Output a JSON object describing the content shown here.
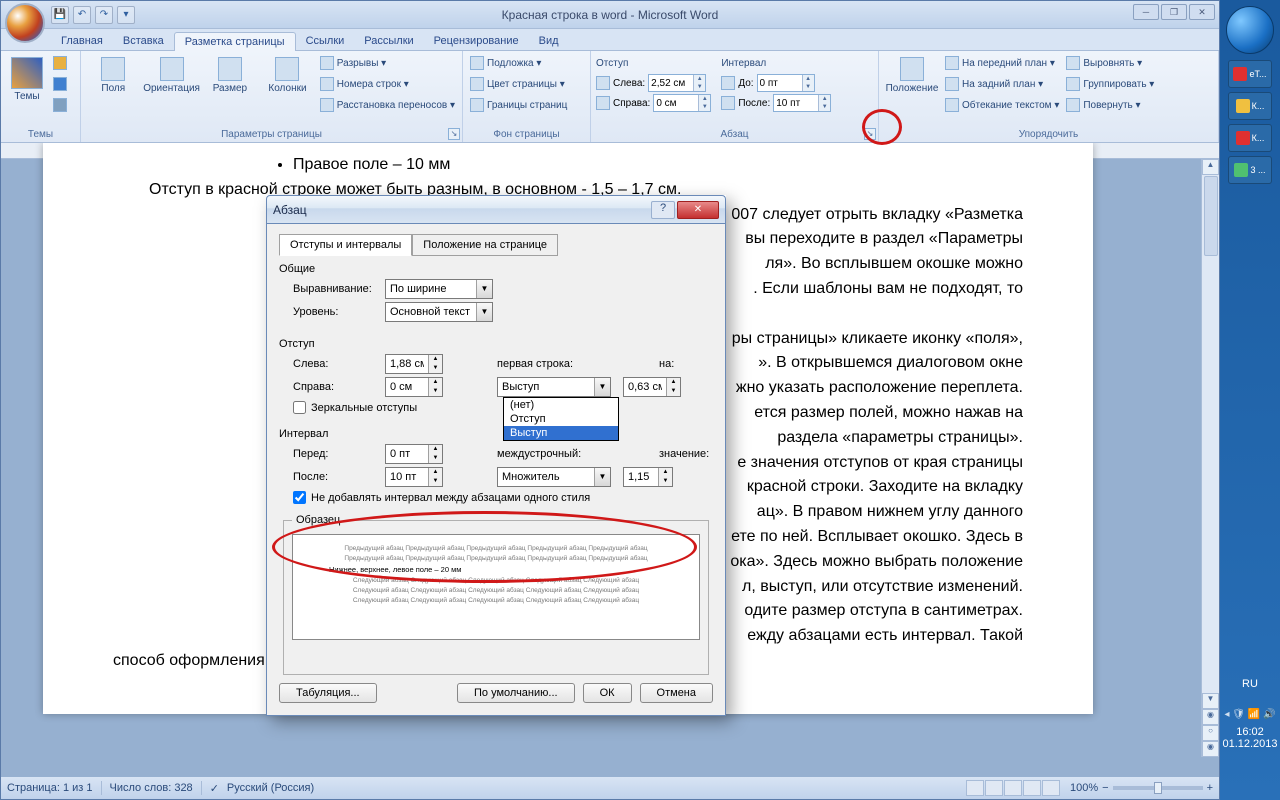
{
  "title": "Красная строка в word - Microsoft Word",
  "tabs": [
    "Главная",
    "Вставка",
    "Разметка страницы",
    "Ссылки",
    "Рассылки",
    "Рецензирование",
    "Вид"
  ],
  "active_tab": 2,
  "ribbon": {
    "themes": {
      "label": "Темы",
      "btn": "Темы"
    },
    "page_setup": {
      "label": "Параметры страницы",
      "margins": "Поля",
      "orientation": "Ориентация",
      "size": "Размер",
      "columns": "Колонки",
      "breaks": "Разрывы ▾",
      "line_numbers": "Номера строк ▾",
      "hyphenation": "Расстановка переносов ▾"
    },
    "page_bg": {
      "label": "Фон страницы",
      "watermark": "Подложка ▾",
      "page_color": "Цвет страницы ▾",
      "borders": "Границы страниц"
    },
    "paragraph": {
      "label": "Абзац",
      "indent_title": "Отступ",
      "left_lbl": "Слева:",
      "left_val": "2,52 см",
      "right_lbl": "Справа:",
      "right_val": "0 см",
      "spacing_title": "Интервал",
      "before_lbl": "До:",
      "before_val": "0 пт",
      "after_lbl": "После:",
      "after_val": "10 пт"
    },
    "arrange": {
      "label": "Упорядочить",
      "position": "Положение",
      "front": "На передний план ▾",
      "back": "На задний план ▾",
      "wrap": "Обтекание текстом ▾",
      "align": "Выровнять ▾",
      "group": "Группировать ▾",
      "rotate": "Повернуть ▾"
    }
  },
  "doc": {
    "bullet": "Правое поле – 10 мм",
    "p1": "Отступ в красной строке может быть разным, в основном  - 1,5 – 1,7 см.",
    "p2a": "007 следует отрыть вкладку «Разметка",
    "p2b": "вы переходите в раздел «Параметры",
    "p2c": "ля».  Во  всплывшем  окошке  можно",
    "p2d": ".  Если  шаблоны  вам  не  подходят,  то",
    "p3a": "ры  страницы»  кликаете  иконку  «поля»,",
    "p3b": "».  В  открывшемся  диалоговом  окне",
    "p3c": "жно указать расположение переплета.",
    "p3d": "ется  размер  полей,  можно  нажав  на",
    "p3e": "раздела «параметры страницы».",
    "p4a": "е  значения  отступов  от  края  страницы",
    "p4b": "красной строки. Заходите на вкладку",
    "p4c": "ац».  В правом нижнем углу данного",
    "p4d": "ете по ней. Всплывает окошко. Здесь в",
    "p4e": "ока». Здесь можно выбрать положение",
    "p4f": "л,  выступ,  или  отсутствие  изменений.",
    "p4g": "одите размер отступа в сантиметрах.",
    "p5a": "ежду абзацами есть интервал.  Такой",
    "p5b": "способ  оформления  более  удобен  для  небольших  документов.  Для  книг  или"
  },
  "dialog": {
    "title": "Абзац",
    "tab1": "Отступы и интервалы",
    "tab2": "Положение на странице",
    "general": "Общие",
    "align_lbl": "Выравнивание:",
    "align_val": "По ширине",
    "outline_lbl": "Уровень:",
    "outline_val": "Основной текст",
    "indent_title": "Отступ",
    "left_lbl": "Слева:",
    "left_val": "1,88 см",
    "right_lbl": "Справа:",
    "right_val": "0 см",
    "mirror": "Зеркальные отступы",
    "first_line_lbl": "первая строка:",
    "first_line_val": "Выступ",
    "at_lbl": "на:",
    "at_val": "0,63 см",
    "dd_opts": [
      "(нет)",
      "Отступ",
      "Выступ"
    ],
    "dd_sel": 2,
    "spacing_title": "Интервал",
    "before_lbl": "Перед:",
    "before_val": "0 пт",
    "after_lbl": "После:",
    "after_val": "10 пт",
    "line_lbl": "междустрочный:",
    "line_val": "Множитель",
    "line_at_lbl": "значение:",
    "line_at_val": "1,15",
    "no_space": "Не добавлять интервал между абзацами одного стиля",
    "preview": "Образец",
    "preview_prev": "Предыдущий абзац Предыдущий абзац Предыдущий абзац Предыдущий абзац Предыдущий абзац",
    "preview_cur": "Нижнее, верхнее, левое поле – 20 мм",
    "preview_next": "Следующий абзац Следующий абзац Следующий абзац Следующий абзац Следующий абзац",
    "tabs_btn": "Табуляция...",
    "default_btn": "По умолчанию...",
    "ok": "ОК",
    "cancel": "Отмена"
  },
  "status": {
    "page": "Страница: 1 из 1",
    "words": "Число слов: 328",
    "lang": "Русский (Россия)",
    "zoom": "100%"
  },
  "sidebar": {
    "apps": [
      {
        "label": "еТ...",
        "cls": "ya-dot"
      },
      {
        "label": "К...",
        "cls": "k-dot"
      },
      {
        "label": "К...",
        "cls": "ya-dot"
      },
      {
        "label": "3 ...",
        "cls": "sk-dot"
      }
    ],
    "lang": "RU",
    "time": "16:02",
    "date": "01.12.2013"
  }
}
